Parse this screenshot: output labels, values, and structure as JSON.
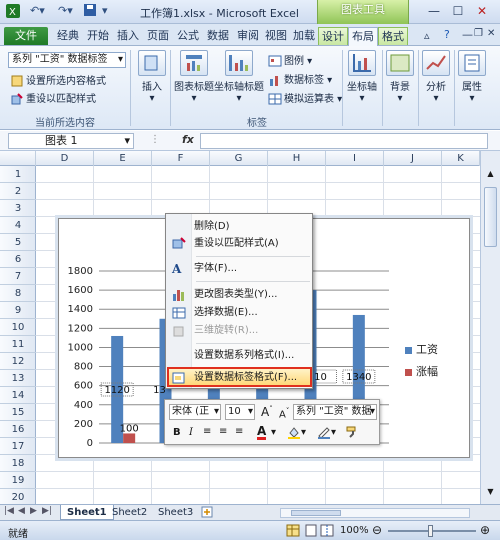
{
  "window": {
    "title": "工作簿1.xlsx - Microsoft Excel",
    "context_tab": "图表工具"
  },
  "tabs": [
    "文件",
    "经典",
    "开始",
    "插入",
    "页面",
    "公式",
    "数据",
    "审阅",
    "视图",
    "加载",
    "设计",
    "布局",
    "格式"
  ],
  "active_tab": "布局",
  "ribbon": {
    "selection_dropdown": "系列 \"工资\" 数据标签",
    "format_selection": "设置所选内容格式",
    "reset_style": "重设以匹配样式",
    "group_current": "当前所选内容",
    "insert": "插入",
    "chart_title": "图表标题",
    "axis_titles": "坐标轴标题",
    "legend": "图例",
    "data_labels": "数据标签",
    "data_table": "模拟运算表",
    "group_labels": "标签",
    "axes": "坐标轴",
    "background": "背景",
    "analysis": "分析",
    "properties": "属性"
  },
  "formula_bar": {
    "name_box": "图表 1",
    "fx": "fx"
  },
  "columns": [
    "D",
    "E",
    "F",
    "G",
    "H",
    "I",
    "J",
    "K"
  ],
  "rows": [
    "1",
    "2",
    "3",
    "4",
    "5",
    "6",
    "7",
    "8",
    "9",
    "10",
    "11",
    "12",
    "13",
    "14",
    "15",
    "16",
    "17",
    "18",
    "19",
    "20"
  ],
  "chart_data": {
    "type": "bar",
    "y_ticks": [
      "0",
      "200",
      "400",
      "600",
      "800",
      "1000",
      "1200",
      "1400",
      "1600",
      "1800"
    ],
    "ylim": [
      0,
      1800
    ],
    "grid": true,
    "legend_position": "right",
    "series": [
      {
        "name": "工资",
        "color": "#4f81bd",
        "values": [
          1120,
          1300,
          1000,
          1150,
          1600,
          1340
        ]
      },
      {
        "name": "涨幅",
        "color": "#c0504d",
        "values": [
          100,
          100,
          100,
          100,
          100,
          100
        ]
      }
    ],
    "visible_labels": {
      "wage_first": "1120",
      "wage_last": "1340",
      "wage_partial_2": "13",
      "wage_partial_5": "10",
      "raise_first": "100"
    }
  },
  "context_menu": {
    "items": [
      {
        "label": "删除(D)",
        "enabled": true
      },
      {
        "label": "重设以匹配样式(A)",
        "enabled": true
      },
      {
        "label": "字体(F)...",
        "enabled": true
      },
      {
        "label": "更改图表类型(Y)...",
        "enabled": true
      },
      {
        "label": "选择数据(E)...",
        "enabled": true
      },
      {
        "label": "三维旋转(R)...",
        "enabled": false
      },
      {
        "label": "设置数据系列格式(I)...",
        "enabled": true
      },
      {
        "label": "设置数据标签格式(F)...",
        "enabled": true
      }
    ]
  },
  "mini_toolbar": {
    "font": "宋体 (正",
    "size": "10",
    "selection": "系列 \"工资\" 数据"
  },
  "sheets": [
    "Sheet1",
    "Sheet2",
    "Sheet3"
  ],
  "status": {
    "ready": "就绪",
    "zoom": "100%"
  }
}
